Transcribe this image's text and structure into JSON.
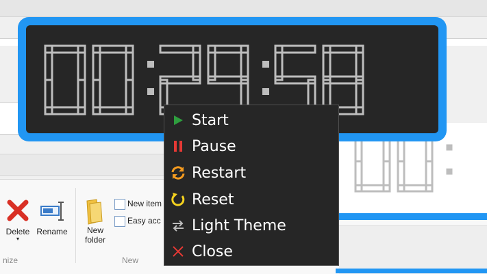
{
  "timer": {
    "display": "00:29:58",
    "segment_color": "#bdbdbd",
    "border_color": "#2196f3",
    "background_color": "#262626"
  },
  "timer_behind": {
    "display_fragment": "00:"
  },
  "context_menu": {
    "items": [
      {
        "label": "Start",
        "icon": "play-icon",
        "icon_color": "#2e9e3e"
      },
      {
        "label": "Pause",
        "icon": "pause-icon",
        "icon_color": "#e53935"
      },
      {
        "label": "Restart",
        "icon": "restart-icon",
        "icon_color": "#f59b1f"
      },
      {
        "label": "Reset",
        "icon": "reset-icon",
        "icon_color": "#f5d21f"
      },
      {
        "label": "Light Theme",
        "icon": "swap-arrows-icon",
        "icon_color": "#bdbdbd"
      },
      {
        "label": "Close",
        "icon": "close-icon",
        "icon_color": "#e53935"
      }
    ]
  },
  "ribbon": {
    "delete_label": "Delete",
    "rename_label": "Rename",
    "new_folder_label": "New\nfolder",
    "new_item_label": "New item",
    "easy_access_label": "Easy acc",
    "organize_group_label": "nize",
    "new_group_label": "New"
  }
}
